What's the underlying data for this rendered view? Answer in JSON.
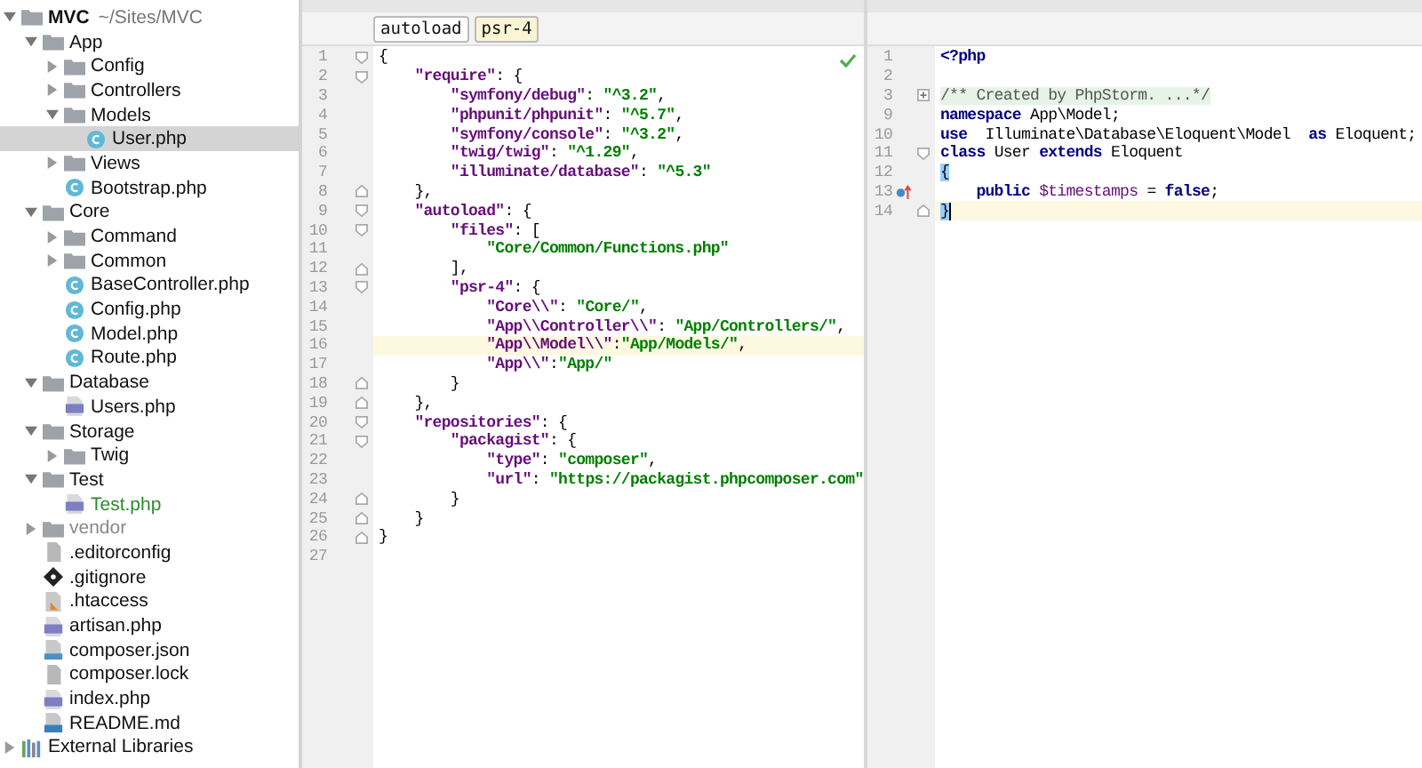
{
  "project_tree": [
    {
      "label": "MVC",
      "path": "~/Sites/MVC",
      "kind": "folder",
      "expanded": true,
      "selected": false,
      "children": [
        {
          "label": "App",
          "kind": "folder",
          "expanded": true,
          "selected": false,
          "children": [
            {
              "label": "Config",
              "kind": "folder",
              "expanded": false,
              "selected": false
            },
            {
              "label": "Controllers",
              "kind": "folder",
              "expanded": false,
              "selected": false
            },
            {
              "label": "Models",
              "kind": "folder",
              "expanded": true,
              "selected": false,
              "children": [
                {
                  "label": "User.php",
                  "kind": "php-class",
                  "selected": true
                }
              ]
            },
            {
              "label": "Views",
              "kind": "folder",
              "expanded": false,
              "selected": false
            },
            {
              "label": "Bootstrap.php",
              "kind": "php-class",
              "selected": false
            }
          ]
        },
        {
          "label": "Core",
          "kind": "folder",
          "expanded": true,
          "selected": false,
          "children": [
            {
              "label": "Command",
              "kind": "folder",
              "expanded": false,
              "selected": false
            },
            {
              "label": "Common",
              "kind": "folder",
              "expanded": false,
              "selected": false
            },
            {
              "label": "BaseController.php",
              "kind": "php-class",
              "selected": false
            },
            {
              "label": "Config.php",
              "kind": "php-class",
              "selected": false
            },
            {
              "label": "Model.php",
              "kind": "php-class",
              "selected": false
            },
            {
              "label": "Route.php",
              "kind": "php-class",
              "selected": false
            }
          ]
        },
        {
          "label": "Database",
          "kind": "folder",
          "expanded": true,
          "selected": false,
          "children": [
            {
              "label": "Users.php",
              "kind": "php",
              "selected": false
            }
          ]
        },
        {
          "label": "Storage",
          "kind": "folder",
          "expanded": true,
          "selected": false,
          "children": [
            {
              "label": "Twig",
              "kind": "folder",
              "expanded": false,
              "selected": false
            }
          ]
        },
        {
          "label": "Test",
          "kind": "folder",
          "expanded": true,
          "selected": false,
          "children": [
            {
              "label": "Test.php",
              "kind": "php",
              "selected": false,
              "color": "#2f8a2f"
            }
          ]
        },
        {
          "label": "vendor",
          "kind": "folder",
          "expanded": false,
          "selected": false,
          "color": "#888888"
        },
        {
          "label": ".editorconfig",
          "kind": "text",
          "selected": false
        },
        {
          "label": ".gitignore",
          "kind": "git",
          "selected": false
        },
        {
          "label": ".htaccess",
          "kind": "htaccess",
          "selected": false
        },
        {
          "label": "artisan.php",
          "kind": "php",
          "selected": false
        },
        {
          "label": "composer.json",
          "kind": "json",
          "selected": false
        },
        {
          "label": "composer.lock",
          "kind": "text",
          "selected": false
        },
        {
          "label": "index.php",
          "kind": "php",
          "selected": false
        },
        {
          "label": "README.md",
          "kind": "md",
          "selected": false
        }
      ]
    },
    {
      "label": "External Libraries",
      "kind": "libraries",
      "expanded": false,
      "selected": false
    }
  ],
  "json_editor": {
    "breadcrumbs": [
      {
        "label": "autoload",
        "selected": false
      },
      {
        "label": "psr-4",
        "selected": true
      }
    ],
    "lines": [
      {
        "number": "1",
        "kind": "fold-start",
        "highlighted": false,
        "tokens": [
          {
            "kind": "punct",
            "text": "{"
          }
        ]
      },
      {
        "number": "2",
        "kind": "fold-start",
        "highlighted": false,
        "tokens": [
          {
            "kind": "key",
            "text": "    \"require\""
          },
          {
            "kind": "punct",
            "text": ": {"
          }
        ]
      },
      {
        "number": "3",
        "kind": "plain",
        "highlighted": false,
        "tokens": [
          {
            "kind": "key",
            "text": "        \"symfony/debug\""
          },
          {
            "kind": "punct",
            "text": ": "
          },
          {
            "kind": "string",
            "text": "\"^3.2\""
          },
          {
            "kind": "punct",
            "text": ","
          }
        ]
      },
      {
        "number": "4",
        "kind": "plain",
        "highlighted": false,
        "tokens": [
          {
            "kind": "key",
            "text": "        \"phpunit/phpunit\""
          },
          {
            "kind": "punct",
            "text": ": "
          },
          {
            "kind": "string",
            "text": "\"^5.7\""
          },
          {
            "kind": "punct",
            "text": ","
          }
        ]
      },
      {
        "number": "5",
        "kind": "plain",
        "highlighted": false,
        "tokens": [
          {
            "kind": "key",
            "text": "        \"symfony/console\""
          },
          {
            "kind": "punct",
            "text": ": "
          },
          {
            "kind": "string",
            "text": "\"^3.2\""
          },
          {
            "kind": "punct",
            "text": ","
          }
        ]
      },
      {
        "number": "6",
        "kind": "plain",
        "highlighted": false,
        "tokens": [
          {
            "kind": "key",
            "text": "        \"twig/twig\""
          },
          {
            "kind": "punct",
            "text": ": "
          },
          {
            "kind": "string",
            "text": "\"^1.29\""
          },
          {
            "kind": "punct",
            "text": ","
          }
        ]
      },
      {
        "number": "7",
        "kind": "plain",
        "highlighted": false,
        "tokens": [
          {
            "kind": "key",
            "text": "        \"illuminate/database\""
          },
          {
            "kind": "punct",
            "text": ": "
          },
          {
            "kind": "string",
            "text": "\"^5.3\""
          }
        ]
      },
      {
        "number": "8",
        "kind": "fold-end",
        "highlighted": false,
        "tokens": [
          {
            "kind": "punct",
            "text": "    },"
          }
        ]
      },
      {
        "number": "9",
        "kind": "fold-start",
        "highlighted": false,
        "tokens": [
          {
            "kind": "key",
            "text": "    \"autoload\""
          },
          {
            "kind": "punct",
            "text": ": {"
          }
        ]
      },
      {
        "number": "10",
        "kind": "fold-start",
        "highlighted": false,
        "tokens": [
          {
            "kind": "key",
            "text": "        \"files\""
          },
          {
            "kind": "punct",
            "text": ": ["
          }
        ]
      },
      {
        "number": "11",
        "kind": "plain",
        "highlighted": false,
        "tokens": [
          {
            "kind": "string",
            "text": "            \"Core/Common/Functions.php\""
          }
        ]
      },
      {
        "number": "12",
        "kind": "fold-end",
        "highlighted": false,
        "tokens": [
          {
            "kind": "punct",
            "text": "        ],"
          }
        ]
      },
      {
        "number": "13",
        "kind": "fold-start",
        "highlighted": false,
        "tokens": [
          {
            "kind": "key",
            "text": "        \"psr-4\""
          },
          {
            "kind": "punct",
            "text": ": {"
          }
        ]
      },
      {
        "number": "14",
        "kind": "plain",
        "highlighted": false,
        "tokens": [
          {
            "kind": "key",
            "text": "            \"Core\\\\\""
          },
          {
            "kind": "punct",
            "text": ": "
          },
          {
            "kind": "string",
            "text": "\"Core/\""
          },
          {
            "kind": "punct",
            "text": ","
          }
        ]
      },
      {
        "number": "15",
        "kind": "plain",
        "highlighted": false,
        "tokens": [
          {
            "kind": "key",
            "text": "            \"App\\\\Controller\\\\\""
          },
          {
            "kind": "punct",
            "text": ": "
          },
          {
            "kind": "string",
            "text": "\"App/Controllers/\""
          },
          {
            "kind": "punct",
            "text": ","
          }
        ]
      },
      {
        "number": "16",
        "kind": "plain",
        "highlighted": true,
        "tokens": [
          {
            "kind": "key",
            "text": "            \"App\\\\Model\\\\\""
          },
          {
            "kind": "punct",
            "text": ":"
          },
          {
            "kind": "string",
            "text": "\"App/Models/\""
          },
          {
            "kind": "punct",
            "text": ","
          }
        ]
      },
      {
        "number": "17",
        "kind": "plain",
        "highlighted": false,
        "tokens": [
          {
            "kind": "key",
            "text": "            \"App\\\\\""
          },
          {
            "kind": "punct",
            "text": ":"
          },
          {
            "kind": "string",
            "text": "\"App/\""
          }
        ]
      },
      {
        "number": "18",
        "kind": "fold-end",
        "highlighted": false,
        "tokens": [
          {
            "kind": "punct",
            "text": "        }"
          }
        ]
      },
      {
        "number": "19",
        "kind": "fold-end",
        "highlighted": false,
        "tokens": [
          {
            "kind": "punct",
            "text": "    },"
          }
        ]
      },
      {
        "number": "20",
        "kind": "fold-start",
        "highlighted": false,
        "tokens": [
          {
            "kind": "key",
            "text": "    \"repositories\""
          },
          {
            "kind": "punct",
            "text": ": {"
          }
        ]
      },
      {
        "number": "21",
        "kind": "fold-start",
        "highlighted": false,
        "tokens": [
          {
            "kind": "key",
            "text": "        \"packagist\""
          },
          {
            "kind": "punct",
            "text": ": {"
          }
        ]
      },
      {
        "number": "22",
        "kind": "plain",
        "highlighted": false,
        "tokens": [
          {
            "kind": "key",
            "text": "            \"type\""
          },
          {
            "kind": "punct",
            "text": ": "
          },
          {
            "kind": "string",
            "text": "\"composer\""
          },
          {
            "kind": "punct",
            "text": ","
          }
        ]
      },
      {
        "number": "23",
        "kind": "plain",
        "highlighted": false,
        "tokens": [
          {
            "kind": "key",
            "text": "            \"url\""
          },
          {
            "kind": "punct",
            "text": ": "
          },
          {
            "kind": "string",
            "text": "\"https://packagist.phpcomposer.com\""
          }
        ]
      },
      {
        "number": "24",
        "kind": "fold-end",
        "highlighted": false,
        "tokens": [
          {
            "kind": "punct",
            "text": "        }"
          }
        ]
      },
      {
        "number": "25",
        "kind": "fold-end",
        "highlighted": false,
        "tokens": [
          {
            "kind": "punct",
            "text": "    }"
          }
        ]
      },
      {
        "number": "26",
        "kind": "fold-end",
        "highlighted": false,
        "tokens": [
          {
            "kind": "punct",
            "text": "}"
          }
        ]
      },
      {
        "number": "27",
        "kind": "plain",
        "highlighted": false
      }
    ]
  },
  "php_editor": {
    "lines": [
      {
        "number": "1",
        "kind": "plain",
        "highlighted": false,
        "marker": false,
        "tokens": [
          {
            "kind": "keyword",
            "text": "<?php"
          }
        ]
      },
      {
        "number": "2",
        "kind": "plain",
        "highlighted": false,
        "marker": false
      },
      {
        "number": "3",
        "kind": "folded",
        "highlighted": false,
        "marker": false,
        "tokens": [
          {
            "kind": "folded",
            "text": "/** Created by PhpStorm. ...*/"
          }
        ]
      },
      {
        "number": "9",
        "kind": "plain",
        "highlighted": false,
        "marker": false,
        "tokens": [
          {
            "kind": "keyword",
            "text": "namespace"
          },
          {
            "kind": "plain",
            "text": " App\\Model;"
          }
        ]
      },
      {
        "number": "10",
        "kind": "plain",
        "highlighted": false,
        "marker": false,
        "tokens": [
          {
            "kind": "keyword",
            "text": "use"
          },
          {
            "kind": "plain",
            "text": "  Illuminate\\Database\\Eloquent\\Model  "
          },
          {
            "kind": "keyword",
            "text": "as"
          },
          {
            "kind": "plain",
            "text": " Eloquent;"
          }
        ]
      },
      {
        "number": "11",
        "kind": "fold-start",
        "highlighted": false,
        "marker": false,
        "tokens": [
          {
            "kind": "keyword",
            "text": "class"
          },
          {
            "kind": "plain",
            "text": " User "
          },
          {
            "kind": "keyword",
            "text": "extends"
          },
          {
            "kind": "plain",
            "text": " Eloquent"
          }
        ]
      },
      {
        "number": "12",
        "kind": "plain",
        "highlighted": false,
        "marker": false,
        "tokens": [
          {
            "kind": "matched",
            "text": "{"
          }
        ]
      },
      {
        "number": "13",
        "kind": "plain",
        "highlighted": false,
        "marker": true,
        "tokens": [
          {
            "kind": "keyword",
            "text": "    public"
          },
          {
            "kind": "var",
            "text": " $timestamps"
          },
          {
            "kind": "plain",
            "text": " = "
          },
          {
            "kind": "keyword",
            "text": "false"
          },
          {
            "kind": "plain",
            "text": ";"
          }
        ]
      },
      {
        "number": "14",
        "kind": "fold-end",
        "highlighted": true,
        "marker": false,
        "tokens": [
          {
            "kind": "matched",
            "text": "}"
          }
        ]
      }
    ]
  }
}
